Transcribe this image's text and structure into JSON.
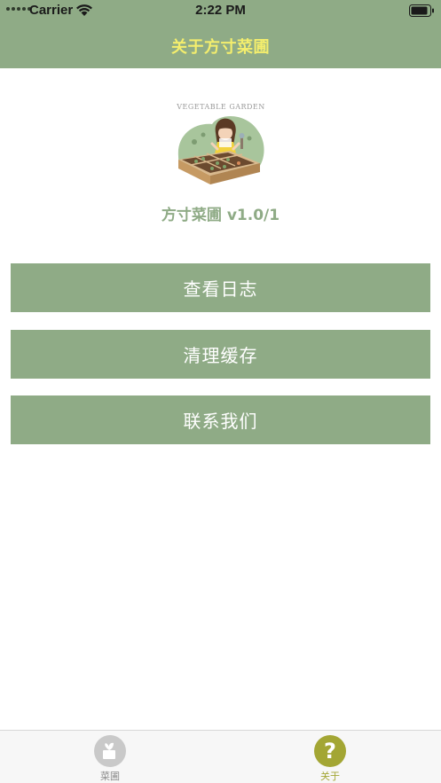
{
  "status_bar": {
    "carrier": "Carrier",
    "time": "2:22 PM"
  },
  "nav": {
    "title": "关于方寸菜圃"
  },
  "app": {
    "logo_caption": "VEGETABLE GARDEN",
    "version_label": "方寸菜圃 v1.0/1"
  },
  "actions": {
    "view_log": "查看日志",
    "clear_cache": "清理缓存",
    "contact_us": "联系我们"
  },
  "tab_bar": {
    "tabs": [
      {
        "label": "菜圃",
        "icon": "garden-icon",
        "selected": false
      },
      {
        "label": "关于",
        "icon": "question-icon",
        "selected": true
      }
    ]
  },
  "colors": {
    "theme_green": "#8fab86",
    "title_yellow": "#f4ee6d",
    "tab_active": "#a3a634",
    "tab_inactive": "#8c8c8c"
  }
}
